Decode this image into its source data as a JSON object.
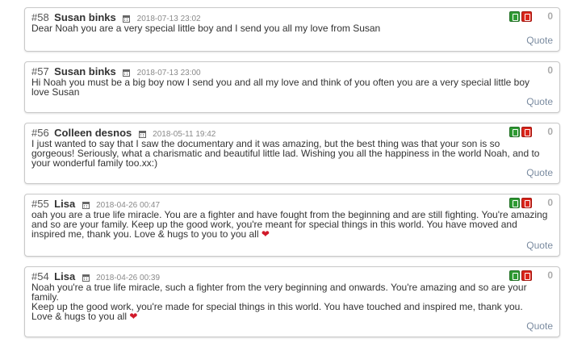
{
  "comments": [
    {
      "num": "#58",
      "author": "Susan binks",
      "date": "2018-07-13 23:02",
      "lines": [
        "Dear Noah you are a very special little boy and I send you all my love from Susan"
      ],
      "score": "0",
      "quote": "Quote",
      "heart": false
    },
    {
      "num": "#57",
      "author": "Susan binks",
      "date": "2018-07-13 23:00",
      "lines": [
        "Hi Noah you must be a big boy now I send you and all my love and think of you often you are a very special little boy",
        "love Susan"
      ],
      "score": "0",
      "quote": "Quote",
      "heart": false
    },
    {
      "num": "#56",
      "author": "Colleen desnos",
      "date": "2018-05-11 19:42",
      "lines": [
        "I just wanted to say that I saw the documentary and it was amazing, but the best thing was that your son is so",
        "gorgeous! Seriously, what a charismatic and beautiful little lad. Wishing you all the happiness in the world Noah, and to",
        "your wonderful family too.xx:)"
      ],
      "score": "0",
      "quote": "Quote",
      "heart": false
    },
    {
      "num": "#55",
      "author": "Lisa",
      "date": "2018-04-26 00:47",
      "lines": [
        "oah you are a true life miracle. You are a fighter and have fought from the beginning and are still fighting. You're amazing",
        "and so are your family. Keep up the good work, you're meant for special things in this world. You have moved and",
        "inspired me, thank you. Love & hugs to you to you all"
      ],
      "score": "0",
      "quote": "Quote",
      "heart": true
    },
    {
      "num": "#54",
      "author": "Lisa",
      "date": "2018-04-26 00:39",
      "lines": [
        "Noah you're a true life miracle, such a fighter from the very beginning and onwards. You're amazing and so are your",
        "family.",
        "Keep up the good work, you're made for special things in this world. You have touched and inspired me, thank you.",
        "Love & hugs to you all"
      ],
      "score": "0",
      "quote": "Quote",
      "heart": true
    }
  ],
  "icons": {
    "like": "thumb-up-icon",
    "dislike": "thumb-down-icon",
    "date": "calendar-icon",
    "heart": "heart-icon"
  },
  "colors": {
    "like": "#2f9a33",
    "dislike": "#d9261c",
    "quote_link": "#7a8ba0",
    "heart": "#d11a2a"
  }
}
